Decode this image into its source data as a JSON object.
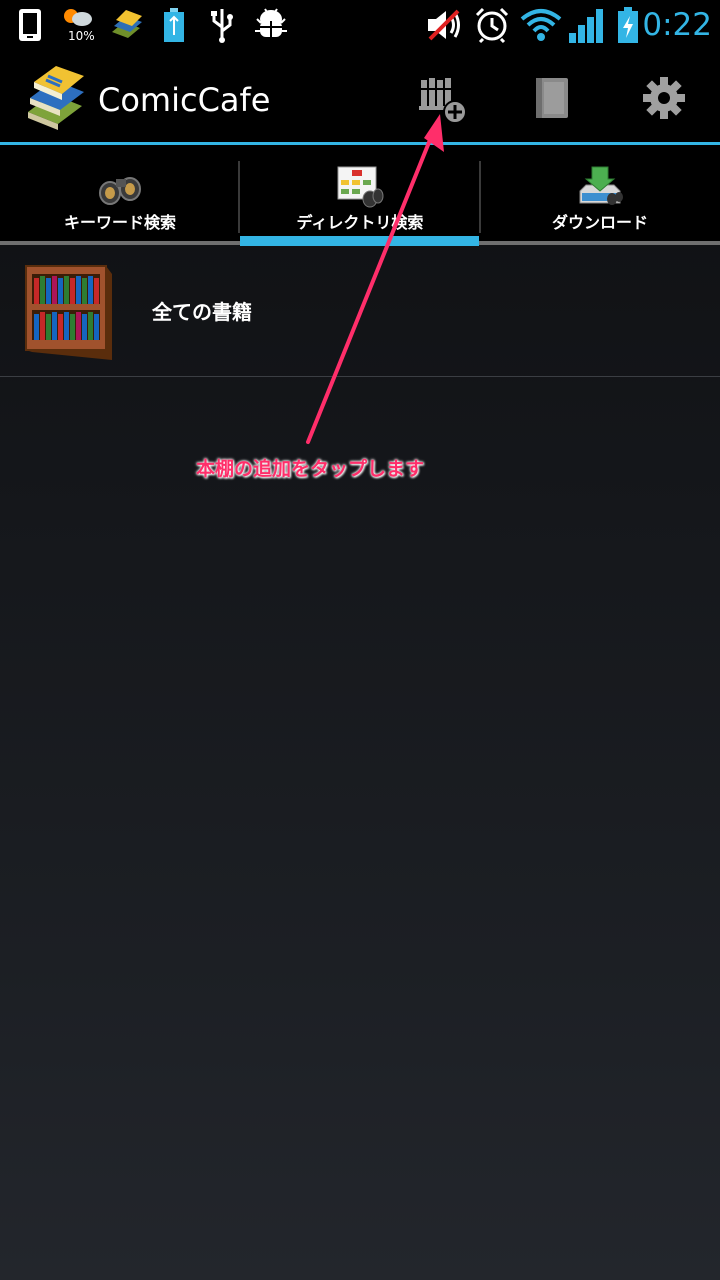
{
  "status_bar": {
    "time": "0:22",
    "weather_percent": "10%",
    "icons": [
      "phone-icon",
      "weather-icon",
      "comiccafe-notification-icon",
      "battery-notification-icon",
      "usb-icon",
      "android-debug-icon",
      "mute-icon",
      "alarm-icon",
      "wifi-icon",
      "signal-icon",
      "battery-charging-icon"
    ]
  },
  "action_bar": {
    "title": "ComicCafe",
    "buttons": [
      "add-bookshelf",
      "book",
      "settings"
    ]
  },
  "tabs": [
    {
      "label": "キーワード検索",
      "selected": false
    },
    {
      "label": "ディレクトリ検索",
      "selected": true
    },
    {
      "label": "ダウンロード",
      "selected": false
    }
  ],
  "list": {
    "items": [
      {
        "label": "全ての書籍"
      }
    ]
  },
  "annotation": {
    "text": "本棚の追加をタップします"
  },
  "colors": {
    "accent": "#33b5e5",
    "annotation": "#ff2e6a"
  }
}
